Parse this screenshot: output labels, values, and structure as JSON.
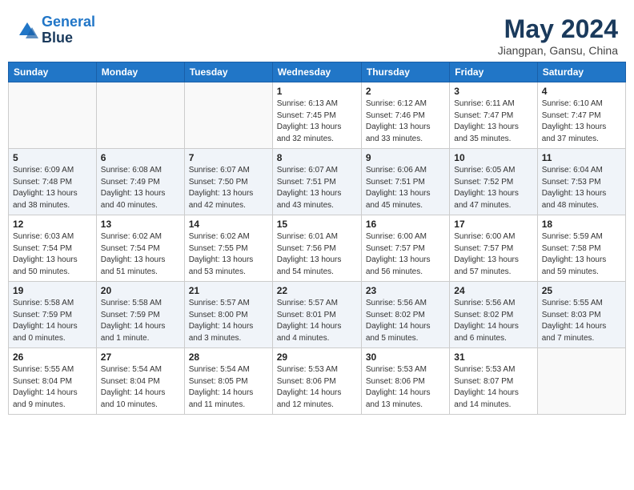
{
  "header": {
    "logo_line1": "General",
    "logo_line2": "Blue",
    "month": "May 2024",
    "location": "Jiangpan, Gansu, China"
  },
  "days_of_week": [
    "Sunday",
    "Monday",
    "Tuesday",
    "Wednesday",
    "Thursday",
    "Friday",
    "Saturday"
  ],
  "weeks": [
    [
      {
        "day": "",
        "info": ""
      },
      {
        "day": "",
        "info": ""
      },
      {
        "day": "",
        "info": ""
      },
      {
        "day": "1",
        "info": "Sunrise: 6:13 AM\nSunset: 7:45 PM\nDaylight: 13 hours\nand 32 minutes."
      },
      {
        "day": "2",
        "info": "Sunrise: 6:12 AM\nSunset: 7:46 PM\nDaylight: 13 hours\nand 33 minutes."
      },
      {
        "day": "3",
        "info": "Sunrise: 6:11 AM\nSunset: 7:47 PM\nDaylight: 13 hours\nand 35 minutes."
      },
      {
        "day": "4",
        "info": "Sunrise: 6:10 AM\nSunset: 7:47 PM\nDaylight: 13 hours\nand 37 minutes."
      }
    ],
    [
      {
        "day": "5",
        "info": "Sunrise: 6:09 AM\nSunset: 7:48 PM\nDaylight: 13 hours\nand 38 minutes."
      },
      {
        "day": "6",
        "info": "Sunrise: 6:08 AM\nSunset: 7:49 PM\nDaylight: 13 hours\nand 40 minutes."
      },
      {
        "day": "7",
        "info": "Sunrise: 6:07 AM\nSunset: 7:50 PM\nDaylight: 13 hours\nand 42 minutes."
      },
      {
        "day": "8",
        "info": "Sunrise: 6:07 AM\nSunset: 7:51 PM\nDaylight: 13 hours\nand 43 minutes."
      },
      {
        "day": "9",
        "info": "Sunrise: 6:06 AM\nSunset: 7:51 PM\nDaylight: 13 hours\nand 45 minutes."
      },
      {
        "day": "10",
        "info": "Sunrise: 6:05 AM\nSunset: 7:52 PM\nDaylight: 13 hours\nand 47 minutes."
      },
      {
        "day": "11",
        "info": "Sunrise: 6:04 AM\nSunset: 7:53 PM\nDaylight: 13 hours\nand 48 minutes."
      }
    ],
    [
      {
        "day": "12",
        "info": "Sunrise: 6:03 AM\nSunset: 7:54 PM\nDaylight: 13 hours\nand 50 minutes."
      },
      {
        "day": "13",
        "info": "Sunrise: 6:02 AM\nSunset: 7:54 PM\nDaylight: 13 hours\nand 51 minutes."
      },
      {
        "day": "14",
        "info": "Sunrise: 6:02 AM\nSunset: 7:55 PM\nDaylight: 13 hours\nand 53 minutes."
      },
      {
        "day": "15",
        "info": "Sunrise: 6:01 AM\nSunset: 7:56 PM\nDaylight: 13 hours\nand 54 minutes."
      },
      {
        "day": "16",
        "info": "Sunrise: 6:00 AM\nSunset: 7:57 PM\nDaylight: 13 hours\nand 56 minutes."
      },
      {
        "day": "17",
        "info": "Sunrise: 6:00 AM\nSunset: 7:57 PM\nDaylight: 13 hours\nand 57 minutes."
      },
      {
        "day": "18",
        "info": "Sunrise: 5:59 AM\nSunset: 7:58 PM\nDaylight: 13 hours\nand 59 minutes."
      }
    ],
    [
      {
        "day": "19",
        "info": "Sunrise: 5:58 AM\nSunset: 7:59 PM\nDaylight: 14 hours\nand 0 minutes."
      },
      {
        "day": "20",
        "info": "Sunrise: 5:58 AM\nSunset: 7:59 PM\nDaylight: 14 hours\nand 1 minute."
      },
      {
        "day": "21",
        "info": "Sunrise: 5:57 AM\nSunset: 8:00 PM\nDaylight: 14 hours\nand 3 minutes."
      },
      {
        "day": "22",
        "info": "Sunrise: 5:57 AM\nSunset: 8:01 PM\nDaylight: 14 hours\nand 4 minutes."
      },
      {
        "day": "23",
        "info": "Sunrise: 5:56 AM\nSunset: 8:02 PM\nDaylight: 14 hours\nand 5 minutes."
      },
      {
        "day": "24",
        "info": "Sunrise: 5:56 AM\nSunset: 8:02 PM\nDaylight: 14 hours\nand 6 minutes."
      },
      {
        "day": "25",
        "info": "Sunrise: 5:55 AM\nSunset: 8:03 PM\nDaylight: 14 hours\nand 7 minutes."
      }
    ],
    [
      {
        "day": "26",
        "info": "Sunrise: 5:55 AM\nSunset: 8:04 PM\nDaylight: 14 hours\nand 9 minutes."
      },
      {
        "day": "27",
        "info": "Sunrise: 5:54 AM\nSunset: 8:04 PM\nDaylight: 14 hours\nand 10 minutes."
      },
      {
        "day": "28",
        "info": "Sunrise: 5:54 AM\nSunset: 8:05 PM\nDaylight: 14 hours\nand 11 minutes."
      },
      {
        "day": "29",
        "info": "Sunrise: 5:53 AM\nSunset: 8:06 PM\nDaylight: 14 hours\nand 12 minutes."
      },
      {
        "day": "30",
        "info": "Sunrise: 5:53 AM\nSunset: 8:06 PM\nDaylight: 14 hours\nand 13 minutes."
      },
      {
        "day": "31",
        "info": "Sunrise: 5:53 AM\nSunset: 8:07 PM\nDaylight: 14 hours\nand 14 minutes."
      },
      {
        "day": "",
        "info": ""
      }
    ]
  ]
}
